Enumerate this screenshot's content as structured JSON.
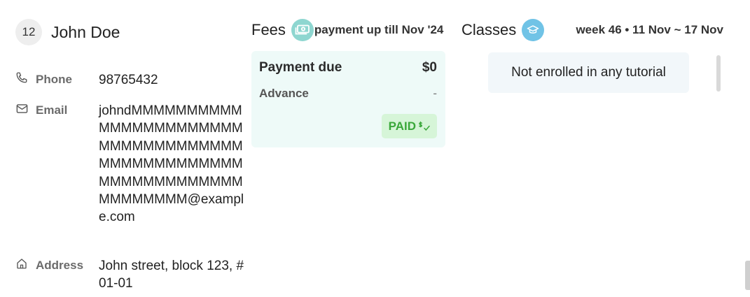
{
  "contact": {
    "index": "12",
    "name": "John Doe",
    "phone": {
      "label": "Phone",
      "value": "98765432",
      "icon": "phone-icon"
    },
    "email": {
      "label": "Email",
      "value": "johndMMMMMMMMMMMMMMMMMMMMMMMMMMMMMMMMMMMMMMMMMMMMMMMMMMMMMMMMMMMMMMMMMMMMMM@example.com",
      "icon": "mail-icon"
    },
    "address": {
      "label": "Address",
      "value": "John street, block 123, #01-01",
      "icon": "home-icon"
    }
  },
  "fees": {
    "title": "Fees",
    "icon": "cash-icon",
    "subtitle": "payment up till Nov '24",
    "payment_due_label": "Payment due",
    "payment_due_value": "$0",
    "advance_label": "Advance",
    "advance_value": "-",
    "status": "PAID",
    "status_icon": "paid-check-icon"
  },
  "classes": {
    "title": "Classes",
    "icon": "graduation-cap-icon",
    "week": "week 46 • 11 Nov ~ 17 Nov",
    "empty_message": "Not enrolled in any tutorial"
  },
  "colors": {
    "fees_card_bg": "#eefaf8",
    "paid_text": "#3aa83a",
    "paid_bg": "#d6f5d8",
    "fees_icon_bg": "#8ed6d0",
    "classes_icon_bg": "#70c3e6",
    "class_card_bg": "#f2f7fa"
  }
}
